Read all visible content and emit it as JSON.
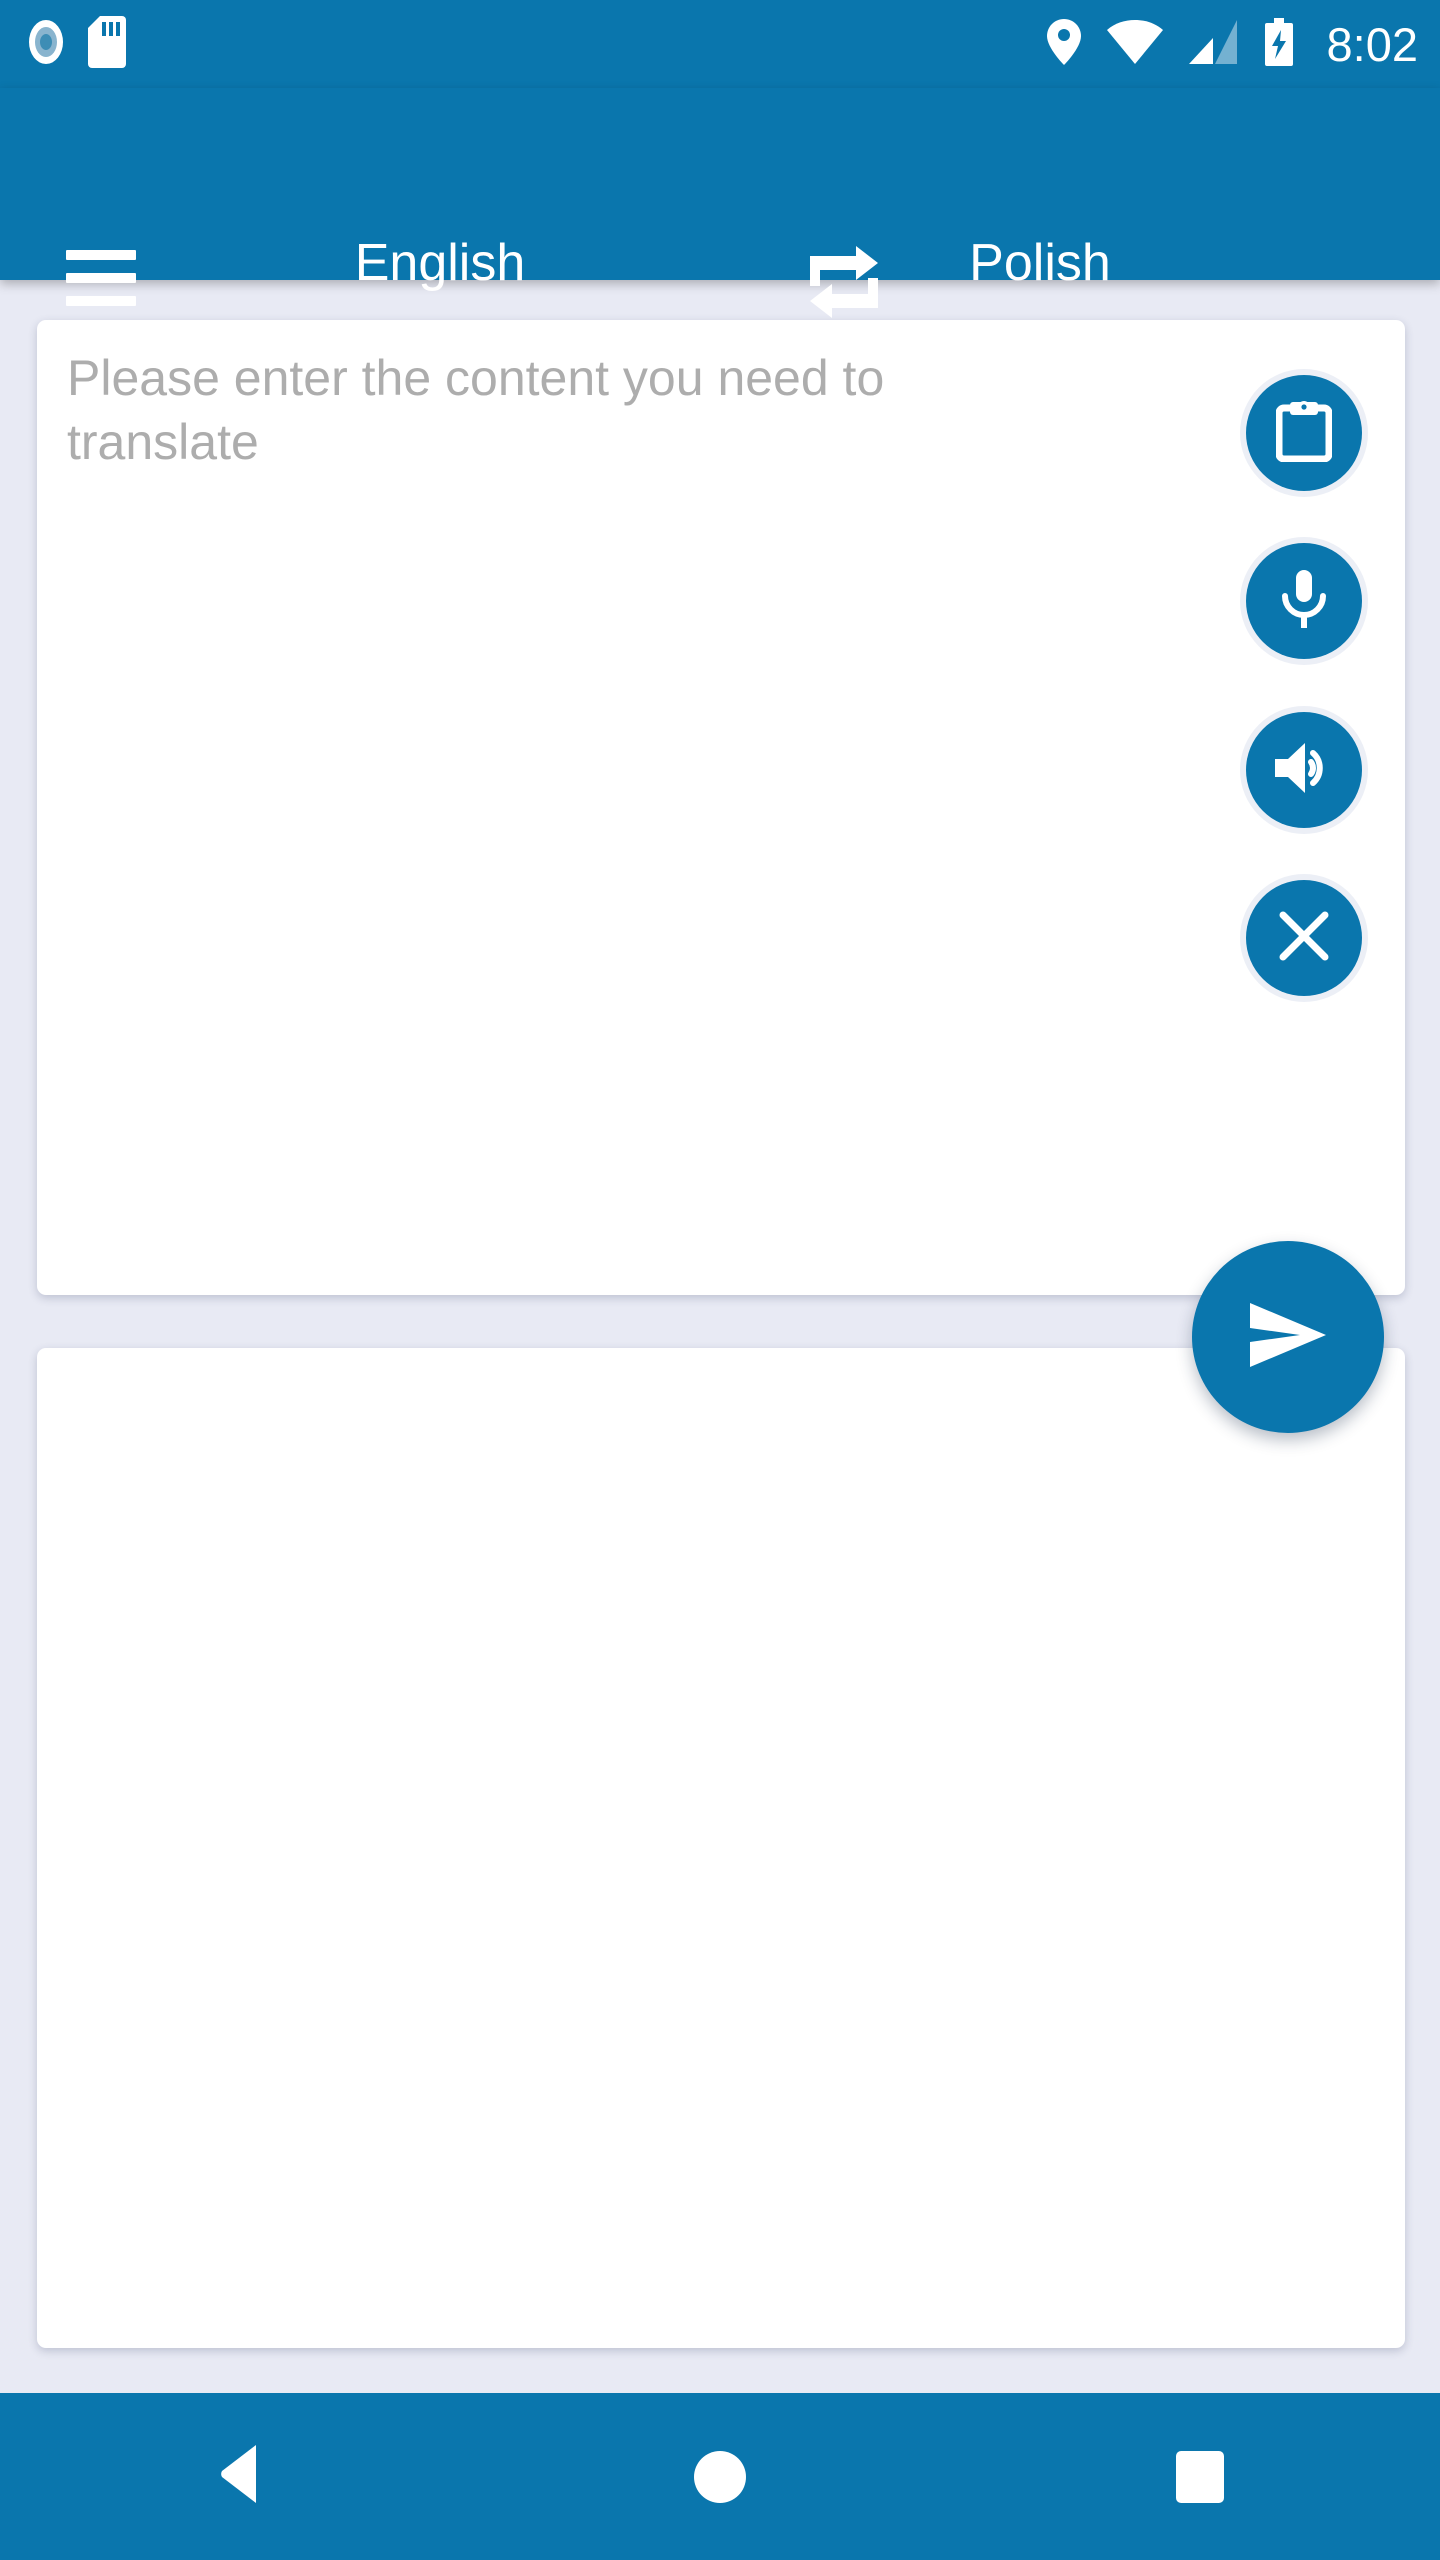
{
  "status_bar": {
    "time": "8:02",
    "left_icons": [
      {
        "name": "nfc-indicator-icon",
        "label": "NFC"
      },
      {
        "name": "sd-card-icon",
        "label": "SD card"
      }
    ],
    "right_icons": [
      {
        "name": "location-pin-icon",
        "label": "Location"
      },
      {
        "name": "wifi-icon",
        "label": "Wi-Fi"
      },
      {
        "name": "cellular-signal-icon",
        "label": "Mobile signal"
      },
      {
        "name": "battery-charging-icon",
        "label": "Battery charging"
      }
    ]
  },
  "app_bar": {
    "menu_label": "Menu",
    "source_language": "English",
    "target_language": "Polish",
    "swap_label": "Swap languages"
  },
  "input_card": {
    "placeholder": "Please enter the content you need to translate",
    "value": "",
    "actions": [
      {
        "name": "paste-button",
        "label": "Paste"
      },
      {
        "name": "mic-button",
        "label": "Voice input"
      },
      {
        "name": "speak-button",
        "label": "Speak"
      },
      {
        "name": "clear-button",
        "label": "Clear"
      }
    ]
  },
  "output_card": {
    "value": ""
  },
  "fab": {
    "label": "Translate"
  },
  "nav_bar": {
    "back_label": "Back",
    "home_label": "Home",
    "recents_label": "Recents"
  },
  "colors": {
    "primary": "#0a76ad",
    "background": "#e8eaf4",
    "card": "#ffffff",
    "placeholder_text": "#adadad",
    "on_primary": "#ffffff"
  }
}
